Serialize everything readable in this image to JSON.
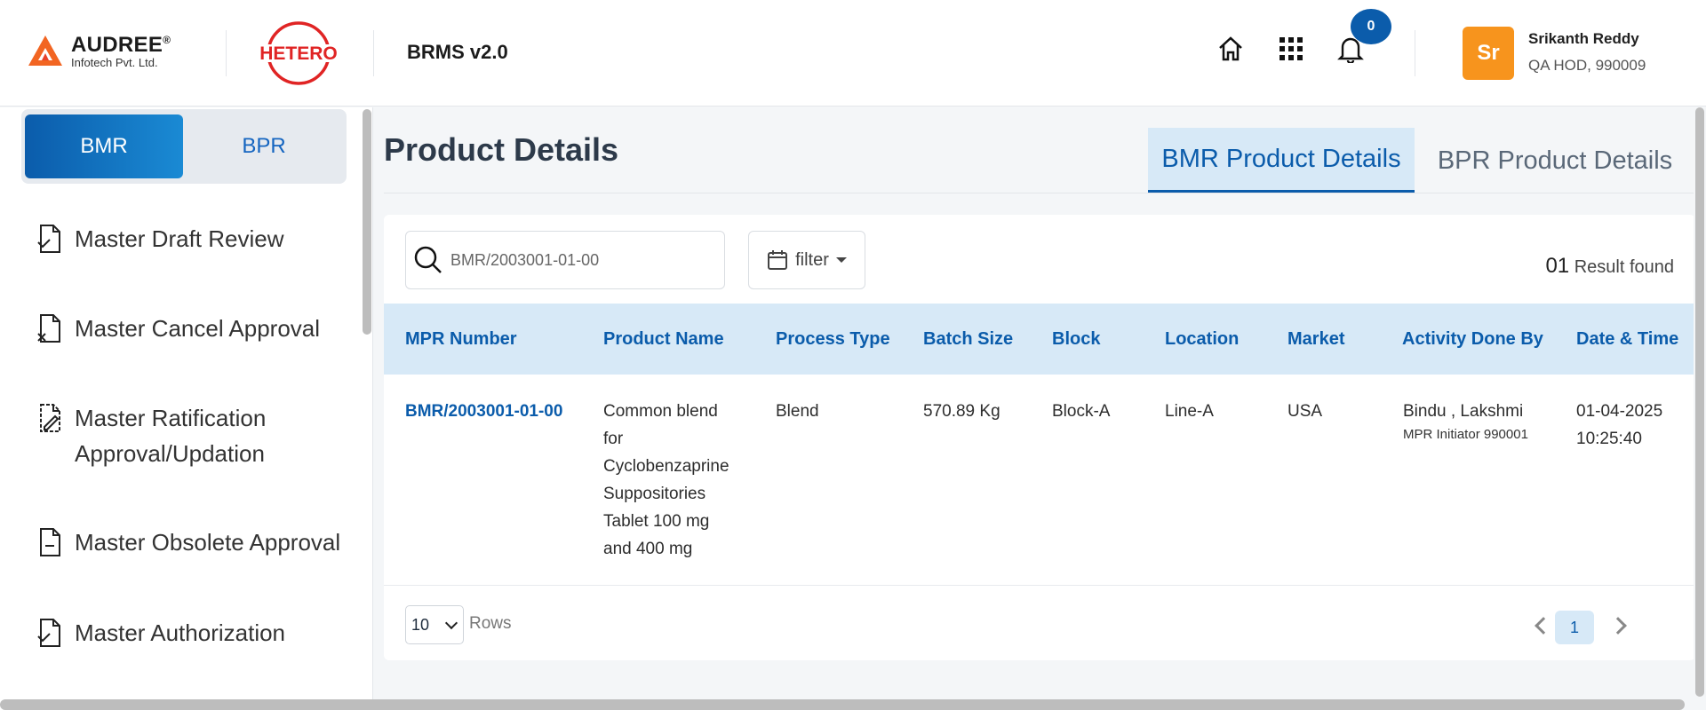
{
  "header": {
    "company_brand": "AUDREE",
    "company_reg": "®",
    "company_sub": "Infotech Pvt. Ltd.",
    "client_logo_text": "HETERO",
    "app_title": "BRMS v2.0",
    "notification_count": "0",
    "icons": [
      "home-icon",
      "apps-grid-icon",
      "bell-icon"
    ],
    "user": {
      "initials": "Sr",
      "name": "Srikanth Reddy",
      "role": "QA HOD, 990009",
      "avatar_color": "#f7941d"
    }
  },
  "sidebar": {
    "segments": [
      {
        "label": "BMR",
        "active": true
      },
      {
        "label": "BPR",
        "active": false
      }
    ],
    "items": [
      {
        "label": "Master Draft Review",
        "icon": "doc-check-icon"
      },
      {
        "label": "Master Cancel Approval",
        "icon": "doc-cancel-icon"
      },
      {
        "label": "Master Ratification Approval/Updation",
        "icon": "doc-edit-icon"
      },
      {
        "label": "Master Obsolete Approval",
        "icon": "doc-minus-icon"
      },
      {
        "label": "Master Authorization",
        "icon": "doc-check-icon"
      }
    ]
  },
  "main": {
    "title": "Product Details",
    "tabs": [
      {
        "label": "BMR Product Details",
        "active": true
      },
      {
        "label": "BPR Product Details",
        "active": false
      }
    ],
    "search": {
      "value": "BMR/2003001-01-00"
    },
    "filter_label": "filter",
    "result_count": "01",
    "result_label": "Result found",
    "table": {
      "columns": [
        "MPR Number",
        "Product Name",
        "Process Type",
        "Batch Size",
        "Block",
        "Location",
        "Market",
        "Activity Done By",
        "Date & Time"
      ],
      "rows": [
        {
          "mpr_number": "BMR/2003001-01-00",
          "product_name": [
            "Common blend",
            "for",
            "Cyclobenzaprine",
            "Suppositories",
            "Tablet 100 mg",
            "and 400 mg"
          ],
          "process_type": "Blend",
          "batch_size": "570.89 Kg",
          "block": "Block-A",
          "location": "Line-A",
          "market": "USA",
          "activity_done_by": "Bindu , Lakshmi",
          "activity_role": "MPR Initiator 990001",
          "date": "01-04-2025",
          "time": "10:25:40"
        }
      ]
    },
    "pagination": {
      "rows_value": "10",
      "rows_label": "Rows",
      "current_page": "1"
    }
  },
  "colors": {
    "primary": "#0b5cab",
    "header_bg": "#d7e9f7",
    "avatar": "#f7941d"
  }
}
